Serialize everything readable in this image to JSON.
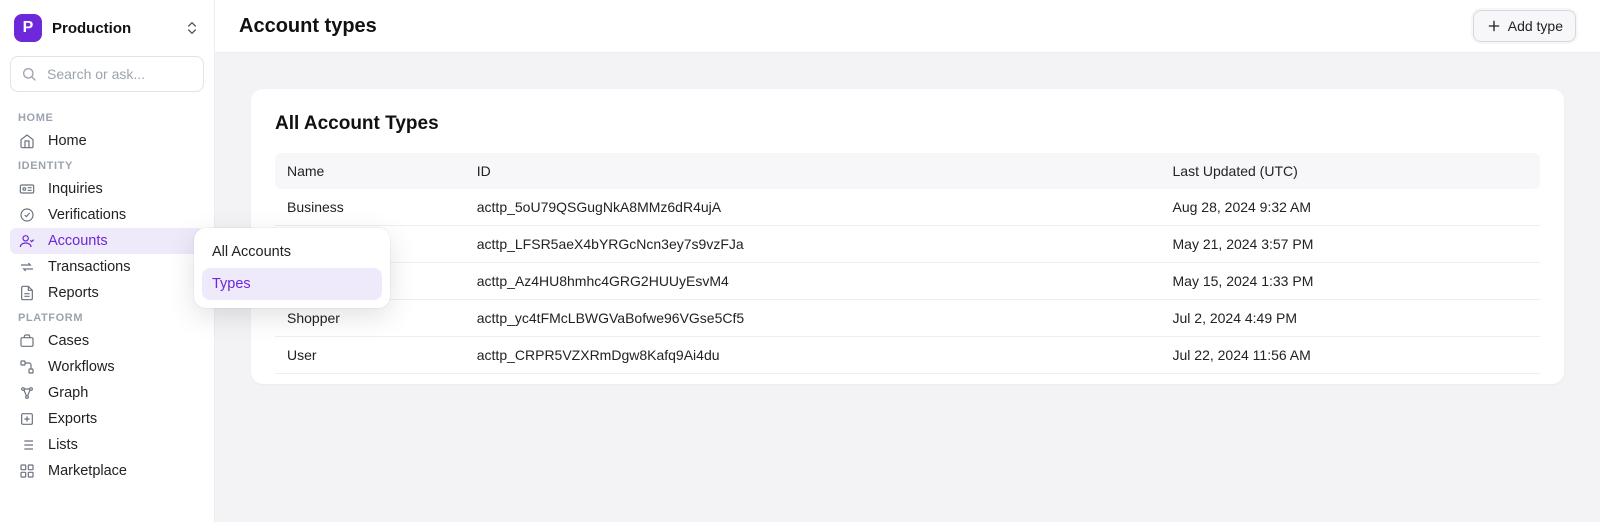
{
  "env": {
    "name": "Production"
  },
  "search": {
    "placeholder": "Search or ask..."
  },
  "sidebar": {
    "sections": {
      "home": {
        "label": "HOME",
        "items": [
          {
            "label": "Home"
          }
        ]
      },
      "identity": {
        "label": "IDENTITY",
        "items": [
          {
            "label": "Inquiries"
          },
          {
            "label": "Verifications"
          },
          {
            "label": "Accounts"
          },
          {
            "label": "Transactions"
          },
          {
            "label": "Reports"
          }
        ]
      },
      "platform": {
        "label": "PLATFORM",
        "items": [
          {
            "label": "Cases"
          },
          {
            "label": "Workflows"
          },
          {
            "label": "Graph"
          },
          {
            "label": "Exports"
          },
          {
            "label": "Lists"
          },
          {
            "label": "Marketplace"
          }
        ]
      }
    }
  },
  "submenu": {
    "items": [
      {
        "label": "All Accounts"
      },
      {
        "label": "Types"
      }
    ]
  },
  "header": {
    "title": "Account types",
    "add_button": "Add type"
  },
  "panel": {
    "title": "All Account Types",
    "columns": {
      "name": "Name",
      "id": "ID",
      "updated": "Last Updated (UTC)"
    },
    "rows": [
      {
        "name": "Business",
        "id": "acttp_5oU79QSGugNkA8MMz6dR4ujA",
        "updated": "Aug 28, 2024 9:32 AM"
      },
      {
        "name": "",
        "id": "acttp_LFSR5aeX4bYRGcNcn3ey7s9vzFJa",
        "updated": "May 21, 2024 3:57 PM"
      },
      {
        "name": "",
        "id": "acttp_Az4HU8hmhc4GRG2HUUyEsvM4",
        "updated": "May 15, 2024 1:33 PM"
      },
      {
        "name": "Shopper",
        "id": "acttp_yc4tFMcLBWGVaBofwe96VGse5Cf5",
        "updated": "Jul 2, 2024 4:49 PM"
      },
      {
        "name": "User",
        "id": "acttp_CRPR5VZXRmDgw8Kafq9Ai4du",
        "updated": "Jul 22, 2024 11:56 AM"
      }
    ]
  }
}
